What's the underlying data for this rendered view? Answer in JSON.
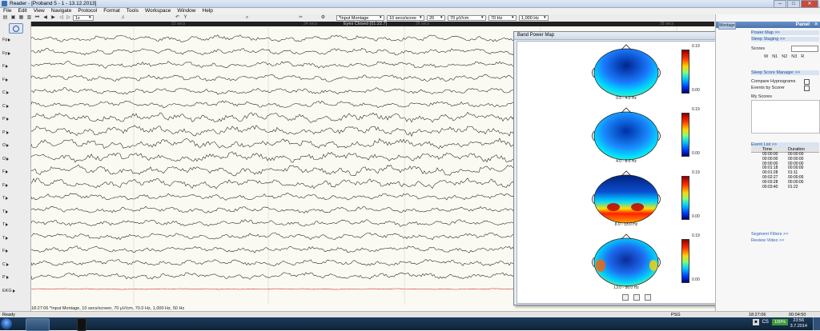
{
  "window": {
    "title": "Reader - [Proband 5 - 1 - 13.12.2013]"
  },
  "menu": [
    "File",
    "Edit",
    "View",
    "Navigate",
    "Protocol",
    "Format",
    "Tools",
    "Workspace",
    "Window",
    "Help"
  ],
  "toolbar": {
    "page_select": "1x",
    "montage": "*Input Montage",
    "timebase": "10 secs/scree",
    "channels": "20",
    "sensitivity": "70 µV/cm",
    "lff": "70 Hz",
    "hff": "1,000 Hz"
  },
  "eeg": {
    "header_center": "Eyes Closed (01:22.7)",
    "time_marks": [
      "22 secs",
      "24 secs",
      "26 secs",
      "28 secs"
    ],
    "channels": [
      "Fp",
      "Fp",
      "F",
      "F",
      "C",
      "C",
      "P",
      "P",
      "O",
      "O",
      "F",
      "F",
      "T",
      "T",
      "T",
      "T",
      "F",
      "C",
      "P",
      "EKG"
    ],
    "status": "18:27:06  *Input Montage, 10 secs/screen, 70 µV/cm, 70.0 Hz, 1,000 Hz, 50 Hz"
  },
  "band_power_map": {
    "title": "Band Power Map",
    "maps": [
      {
        "band": "0.5 - 4.0 Hz",
        "scale_max": "0.19",
        "scale_min": "0.00"
      },
      {
        "band": "4.0 - 8.0 Hz",
        "scale_max": "0.19",
        "scale_min": "0.00"
      },
      {
        "band": "8.0 - 13.0 Hz",
        "scale_max": "0.19",
        "scale_min": "0.00"
      },
      {
        "band": "13.0 - 30.0 Hz",
        "scale_max": "0.19",
        "scale_min": "0.00"
      }
    ]
  },
  "panel": {
    "tab": "Montage",
    "title": "Panel",
    "power_map": "Power Map >>",
    "sleep_staging": "Sleep Staging >>",
    "scores_label": "Scores",
    "stage_buttons": [
      "W",
      "N1",
      "N2",
      "N3",
      "R"
    ],
    "score_manager": "Sleep Score Manager >>",
    "compare_hypnograms": "Compare Hypnograms",
    "events_by_scorer": "Events by Scorer",
    "my_scores": "My Scores",
    "event_list": "Event List >>",
    "ev_columns": [
      "",
      "Time",
      "Duration"
    ],
    "events": [
      {
        "t": "00:00:00",
        "d": "00:00:00"
      },
      {
        "t": "00:00:00",
        "d": "00:00:00"
      },
      {
        "t": "00:00:00",
        "d": "00:00:00"
      },
      {
        "t": "00:01:18",
        "d": "00:00:00"
      },
      {
        "t": "00:01:28",
        "d": "01:11"
      },
      {
        "t": "00:02:27",
        "d": "00:00:00"
      },
      {
        "t": "00:03:28",
        "d": "00:00:00"
      },
      {
        "t": "00:03:40",
        "d": "01:22"
      }
    ],
    "segment_filters": "Segment Filters >>",
    "review_video": "Review Video >>"
  },
  "statusbar": {
    "left": "Ready",
    "psg": "PSG",
    "time1": "18:27:06",
    "time2": "00:04:50"
  },
  "taskbar": {
    "lang": "CS",
    "battery": "100%",
    "clock_time": "23:56",
    "clock_date": "3.7.2014"
  }
}
